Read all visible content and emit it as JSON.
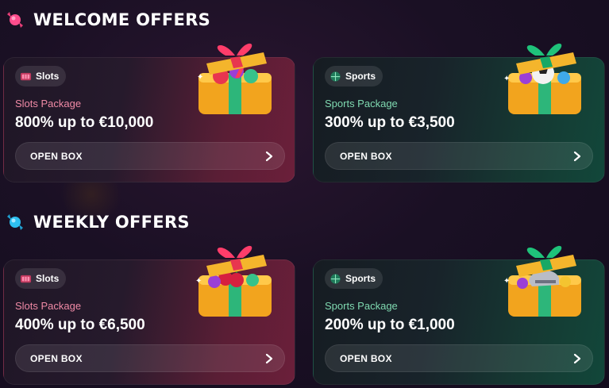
{
  "sections": [
    {
      "title": "WELCOME OFFERS",
      "icon": "pink-candy-icon",
      "cards": [
        {
          "tag": "Slots",
          "tag_icon": "slot-machine-icon",
          "package": "Slots Package",
          "value": "800% up to €10,000",
          "button": "OPEN BOX",
          "theme": "slots",
          "gift_icon": "gift-box-slots-icon"
        },
        {
          "tag": "Sports",
          "tag_icon": "ball-icon",
          "package": "Sports Package",
          "value": "300% up to €3,500",
          "button": "OPEN BOX",
          "theme": "sports",
          "gift_icon": "gift-box-sports-icon"
        }
      ]
    },
    {
      "title": "WEEKLY OFFERS",
      "icon": "blue-candy-icon",
      "cards": [
        {
          "tag": "Slots",
          "tag_icon": "slot-machine-icon",
          "package": "Slots Package",
          "value": "400% up to €6,500",
          "button": "OPEN BOX",
          "theme": "slots",
          "gift_icon": "gift-box-slots-icon"
        },
        {
          "tag": "Sports",
          "tag_icon": "ball-icon",
          "package": "Sports Package",
          "value": "200% up to €1,000",
          "button": "OPEN BOX",
          "theme": "sports",
          "gift_icon": "gift-box-sports-icon"
        }
      ]
    }
  ],
  "colors": {
    "slots_accent": "#f08aa6",
    "sports_accent": "#7fd9b0",
    "background": "#1a1024"
  }
}
